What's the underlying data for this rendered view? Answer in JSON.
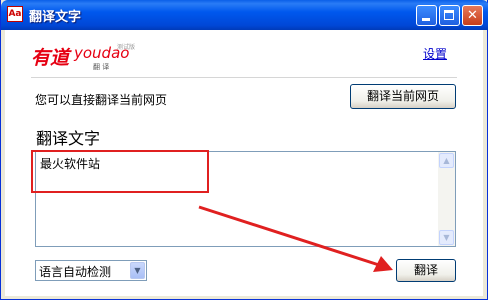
{
  "window": {
    "title": "翻译文字",
    "icon_text": "Aa"
  },
  "header": {
    "logo": {
      "brand_cn": "有道",
      "brand_en": "youdao",
      "badge": "测试版",
      "sub": "翻 译"
    },
    "settings_label": "设置"
  },
  "page_translate": {
    "hint": "您可以直接翻译当前网页",
    "button_label": "翻译当前网页"
  },
  "translate": {
    "heading": "翻译文字",
    "input_text": "最火软件站",
    "language_select": "语言自动检测",
    "button_label": "翻译"
  },
  "colors": {
    "annotation": "#e02020",
    "link": "#0000cc",
    "titlebar": "#0058ee"
  }
}
